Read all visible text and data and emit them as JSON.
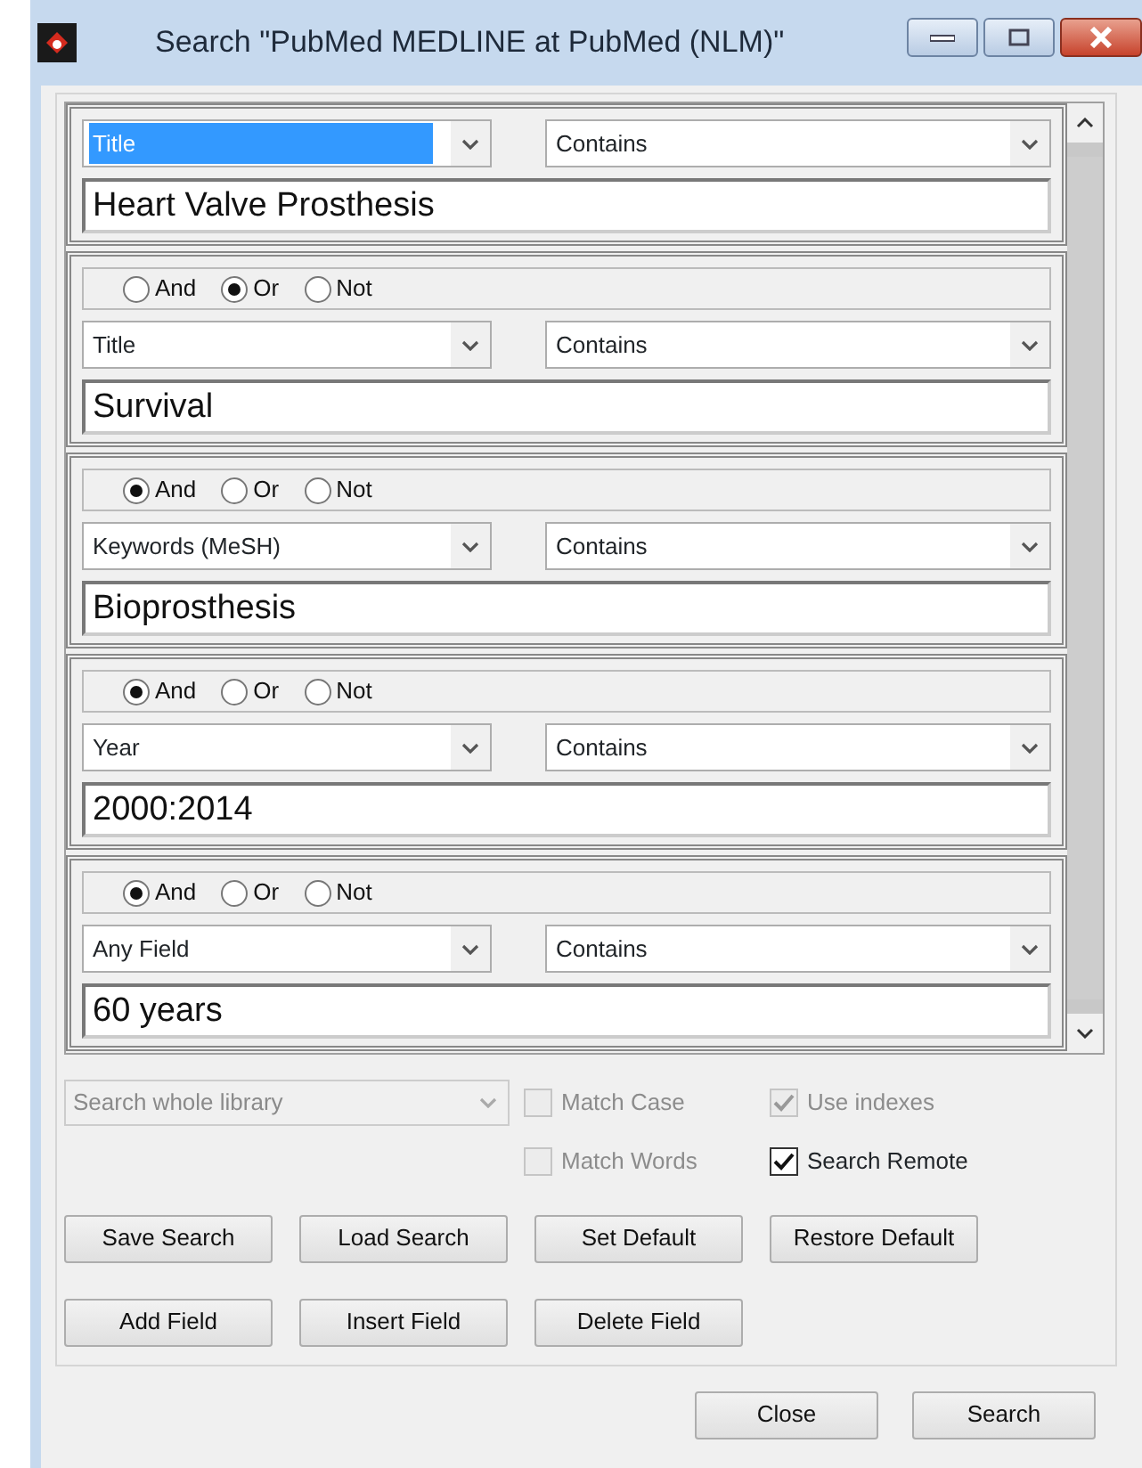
{
  "window": {
    "title": "Search \"PubMed MEDLINE at PubMed (NLM)\""
  },
  "criteria": [
    {
      "field": {
        "value": "Title",
        "highlighted": true
      },
      "operator": "Contains",
      "text": "Heart Valve Prosthesis"
    },
    {
      "connectors": [
        {
          "label": "And",
          "selected": false
        },
        {
          "label": "Or",
          "selected": true
        },
        {
          "label": "Not",
          "selected": false
        }
      ],
      "field": {
        "value": "Title",
        "highlighted": false
      },
      "operator": "Contains",
      "text": "Survival"
    },
    {
      "connectors": [
        {
          "label": "And",
          "selected": true
        },
        {
          "label": "Or",
          "selected": false
        },
        {
          "label": "Not",
          "selected": false
        }
      ],
      "field": {
        "value": "Keywords (MeSH)",
        "highlighted": false
      },
      "operator": "Contains",
      "text": "Bioprosthesis"
    },
    {
      "connectors": [
        {
          "label": "And",
          "selected": true
        },
        {
          "label": "Or",
          "selected": false
        },
        {
          "label": "Not",
          "selected": false
        }
      ],
      "field": {
        "value": "Year",
        "highlighted": false
      },
      "operator": "Contains",
      "text": "2000:2014"
    },
    {
      "connectors": [
        {
          "label": "And",
          "selected": true
        },
        {
          "label": "Or",
          "selected": false
        },
        {
          "label": "Not",
          "selected": false
        }
      ],
      "field": {
        "value": "Any Field",
        "highlighted": false
      },
      "operator": "Contains",
      "text": "60 years"
    }
  ],
  "scope": {
    "value": "Search whole library",
    "disabled": true
  },
  "checkboxes": [
    {
      "label": "Match Case",
      "checked": false,
      "disabled": true
    },
    {
      "label": "Use indexes",
      "checked": true,
      "disabled": true
    },
    {
      "label": "Match Words",
      "checked": false,
      "disabled": true
    },
    {
      "label": "Search Remote",
      "checked": true,
      "disabled": false
    }
  ],
  "button_rows": [
    [
      "Save Search",
      "Load Search",
      "Set Default",
      "Restore Default"
    ],
    [
      "Add Field",
      "Insert Field",
      "Delete Field"
    ]
  ],
  "footer_buttons": [
    "Close",
    "Search"
  ]
}
